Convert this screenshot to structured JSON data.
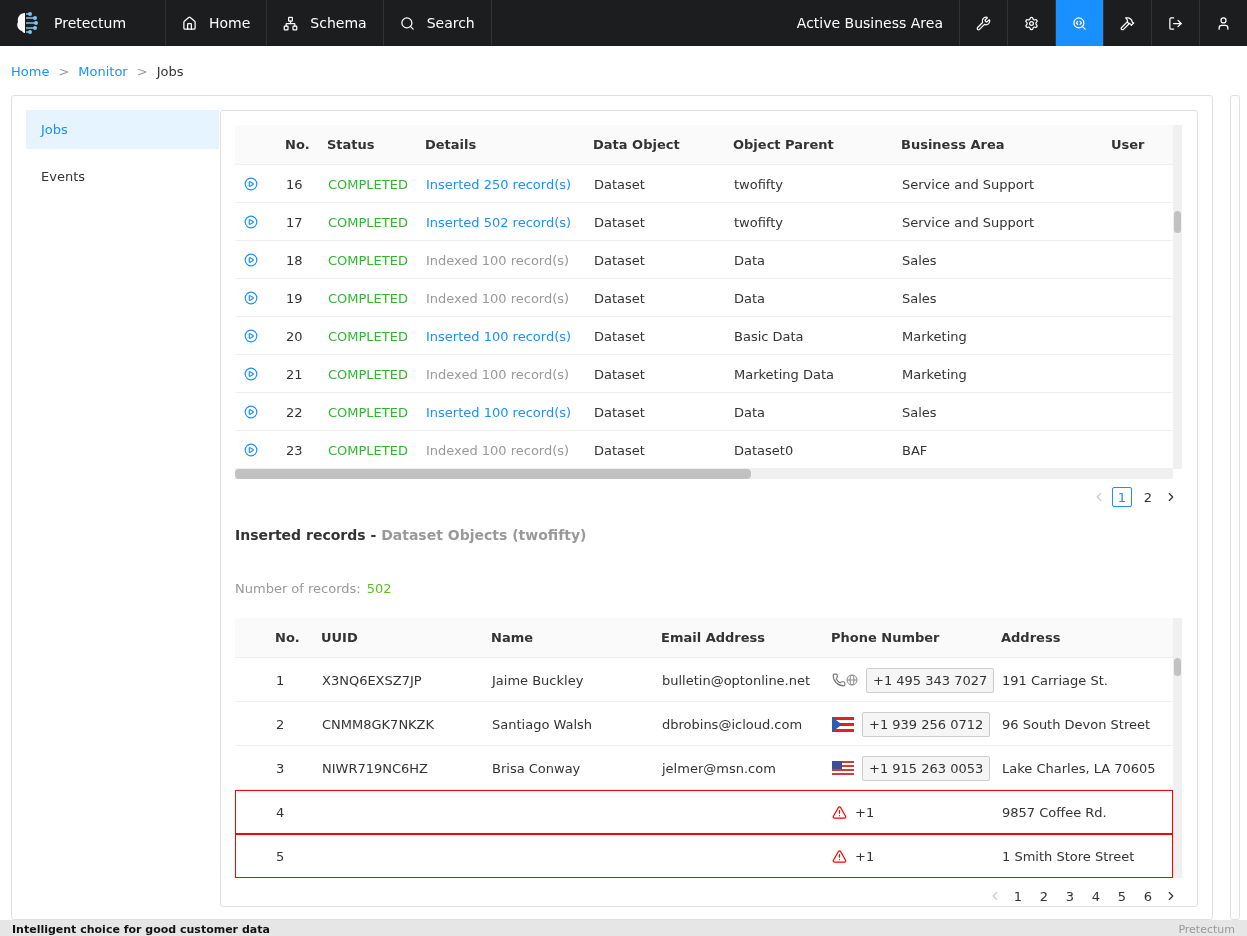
{
  "topbar": {
    "brand": "Pretectum",
    "nav": [
      {
        "label": "Home"
      },
      {
        "label": "Schema"
      },
      {
        "label": "Search"
      }
    ],
    "area": "Active Business Area",
    "tools": [
      {
        "selected": false
      },
      {
        "selected": false
      },
      {
        "selected": true
      },
      {
        "selected": false
      },
      {
        "selected": false
      },
      {
        "selected": false
      }
    ]
  },
  "breadcrumb": [
    {
      "label": "Home",
      "kind": "link"
    },
    {
      "label": ">",
      "kind": "separator"
    },
    {
      "label": "Monitor",
      "kind": "link"
    },
    {
      "label": ">",
      "kind": "separator"
    },
    {
      "label": "Jobs",
      "kind": "current"
    }
  ],
  "sidebar": {
    "items": [
      {
        "label": "Jobs",
        "selected": true
      },
      {
        "label": "Events",
        "selected": false
      }
    ]
  },
  "jobs": {
    "columns": [
      "No.",
      "Status",
      "Details",
      "Data Object",
      "Object Parent",
      "Business Area",
      "User"
    ],
    "rows": [
      {
        "no": "16",
        "status": "COMPLETED",
        "details": "Inserted 250 record(s)",
        "linked": true,
        "object": "Dataset",
        "parent": "twofifty",
        "area": "Service and Support"
      },
      {
        "no": "17",
        "status": "COMPLETED",
        "details": "Inserted 502 record(s)",
        "linked": true,
        "object": "Dataset",
        "parent": "twofifty",
        "area": "Service and Support"
      },
      {
        "no": "18",
        "status": "COMPLETED",
        "details": "Indexed 100 record(s)",
        "linked": false,
        "object": "Dataset",
        "parent": "Data",
        "area": "Sales"
      },
      {
        "no": "19",
        "status": "COMPLETED",
        "details": "Indexed 100 record(s)",
        "linked": false,
        "object": "Dataset",
        "parent": "Data",
        "area": "Sales"
      },
      {
        "no": "20",
        "status": "COMPLETED",
        "details": "Inserted 100 record(s)",
        "linked": true,
        "object": "Dataset",
        "parent": "Basic Data",
        "area": "Marketing"
      },
      {
        "no": "21",
        "status": "COMPLETED",
        "details": "Indexed 100 record(s)",
        "linked": false,
        "object": "Dataset",
        "parent": "Marketing Data",
        "area": "Marketing"
      },
      {
        "no": "22",
        "status": "COMPLETED",
        "details": "Inserted 100 record(s)",
        "linked": true,
        "object": "Dataset",
        "parent": "Data",
        "area": "Sales"
      },
      {
        "no": "23",
        "status": "COMPLETED",
        "details": "Indexed 100 record(s)",
        "linked": false,
        "object": "Dataset",
        "parent": "Dataset0",
        "area": "BAF"
      }
    ],
    "pages": [
      {
        "label": "1",
        "selected": true
      },
      {
        "label": "2",
        "selected": false
      }
    ]
  },
  "records": {
    "title": "Inserted records - ",
    "subtitle": "Dataset Objects (twofifty)",
    "count_label": "Number of records:",
    "count": "502",
    "columns": [
      "No.",
      "UUID",
      "Name",
      "Email Address",
      "Phone Number",
      "Address"
    ],
    "rows": [
      {
        "no": "1",
        "uuid": "X3NQ6EXSZ7JP",
        "name": "Jaime Buckley",
        "email": "bulletin@optonline.net",
        "invalid": false,
        "phone": "+1 495 343 7027",
        "address": "191 Carriage St."
      },
      {
        "no": "2",
        "uuid": "CNMM8GK7NKZK",
        "name": "Santiago Walsh",
        "email": "dbrobins@icloud.com",
        "invalid": false,
        "phone": "+1 939 256 0712",
        "address": "96 South Devon Street"
      },
      {
        "no": "3",
        "uuid": "NIWR719NC6HZ",
        "name": "Brisa Conway",
        "email": "jelmer@msn.com",
        "invalid": false,
        "phone": "+1 915 263 0053",
        "address": "Lake Charles, LA 70605"
      },
      {
        "no": "4",
        "invalid": true,
        "phone": "+1",
        "address": "9857 Coffee Rd."
      },
      {
        "no": "5",
        "invalid": true,
        "phone": "+1",
        "address": "1 Smith Store Street"
      }
    ],
    "pages": [
      {
        "label": "1",
        "selected": false
      },
      {
        "label": "2",
        "selected": false
      },
      {
        "label": "3",
        "selected": false
      },
      {
        "label": "4",
        "selected": false
      },
      {
        "label": "5",
        "selected": false
      },
      {
        "label": "6",
        "selected": false
      }
    ]
  },
  "footer": {
    "tagline": "Intelligent choice for good customer data",
    "brand": "Pretectum"
  }
}
